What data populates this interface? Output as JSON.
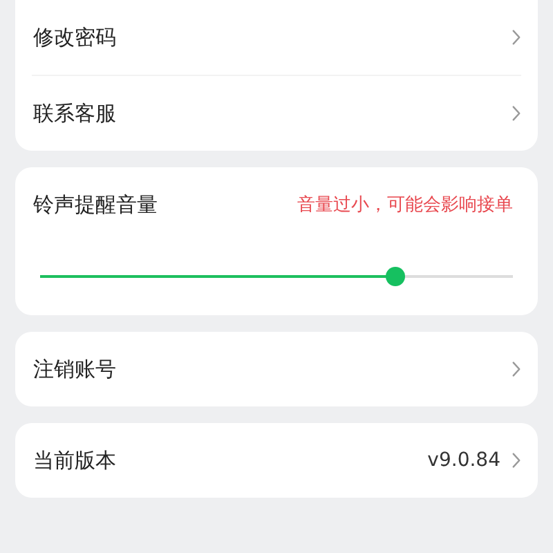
{
  "menu_group": [
    {
      "label": "修改密码"
    },
    {
      "label": "联系客服"
    }
  ],
  "ringtone_volume": {
    "title": "铃声提醒音量",
    "warning": "音量过小，可能会影响接单",
    "level": 0.75
  },
  "cancel_account": {
    "label": "注销账号"
  },
  "current_version": {
    "label": "当前版本",
    "value": "v9.0.84"
  }
}
